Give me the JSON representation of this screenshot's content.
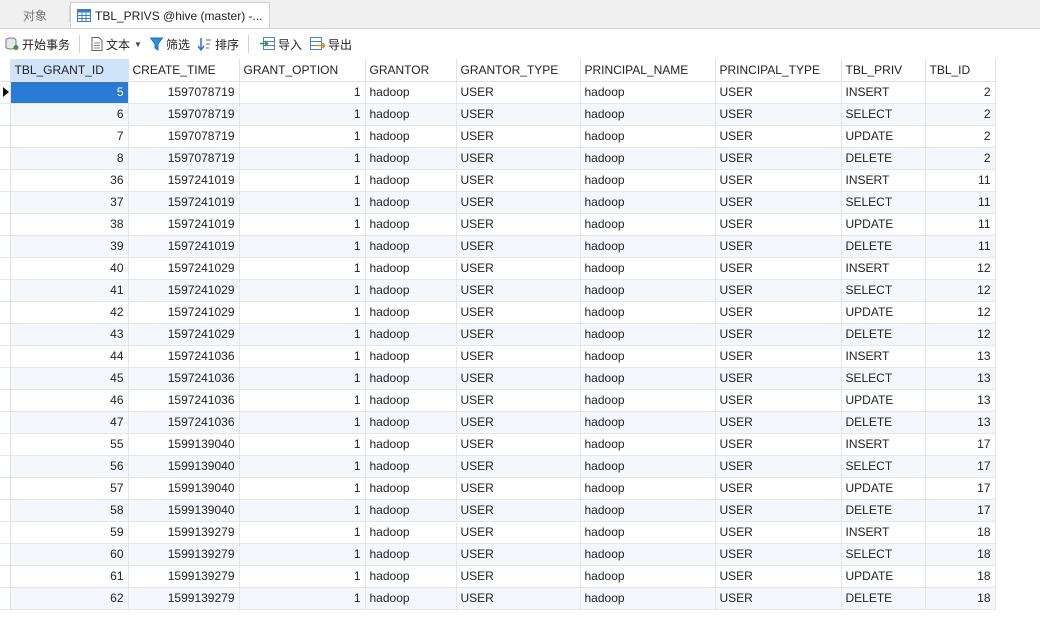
{
  "tabs": {
    "objects": "对象",
    "active": "TBL_PRIVS @hive (master) -..."
  },
  "toolbar": {
    "begin_transaction": "开始事务",
    "text": "文本",
    "filter": "筛选",
    "sort": "排序",
    "import": "导入",
    "export": "导出"
  },
  "colors": {
    "selection": "#2a7ad6",
    "header_selected": "#cfe4fb",
    "stripe": "#f4f8fd"
  },
  "columns": [
    "TBL_GRANT_ID",
    "CREATE_TIME",
    "GRANT_OPTION",
    "GRANTOR",
    "GRANTOR_TYPE",
    "PRINCIPAL_NAME",
    "PRINCIPAL_TYPE",
    "TBL_PRIV",
    "TBL_ID"
  ],
  "rows": [
    [
      "5",
      "1597078719",
      "1",
      "hadoop",
      "USER",
      "hadoop",
      "USER",
      "INSERT",
      "2"
    ],
    [
      "6",
      "1597078719",
      "1",
      "hadoop",
      "USER",
      "hadoop",
      "USER",
      "SELECT",
      "2"
    ],
    [
      "7",
      "1597078719",
      "1",
      "hadoop",
      "USER",
      "hadoop",
      "USER",
      "UPDATE",
      "2"
    ],
    [
      "8",
      "1597078719",
      "1",
      "hadoop",
      "USER",
      "hadoop",
      "USER",
      "DELETE",
      "2"
    ],
    [
      "36",
      "1597241019",
      "1",
      "hadoop",
      "USER",
      "hadoop",
      "USER",
      "INSERT",
      "11"
    ],
    [
      "37",
      "1597241019",
      "1",
      "hadoop",
      "USER",
      "hadoop",
      "USER",
      "SELECT",
      "11"
    ],
    [
      "38",
      "1597241019",
      "1",
      "hadoop",
      "USER",
      "hadoop",
      "USER",
      "UPDATE",
      "11"
    ],
    [
      "39",
      "1597241019",
      "1",
      "hadoop",
      "USER",
      "hadoop",
      "USER",
      "DELETE",
      "11"
    ],
    [
      "40",
      "1597241029",
      "1",
      "hadoop",
      "USER",
      "hadoop",
      "USER",
      "INSERT",
      "12"
    ],
    [
      "41",
      "1597241029",
      "1",
      "hadoop",
      "USER",
      "hadoop",
      "USER",
      "SELECT",
      "12"
    ],
    [
      "42",
      "1597241029",
      "1",
      "hadoop",
      "USER",
      "hadoop",
      "USER",
      "UPDATE",
      "12"
    ],
    [
      "43",
      "1597241029",
      "1",
      "hadoop",
      "USER",
      "hadoop",
      "USER",
      "DELETE",
      "12"
    ],
    [
      "44",
      "1597241036",
      "1",
      "hadoop",
      "USER",
      "hadoop",
      "USER",
      "INSERT",
      "13"
    ],
    [
      "45",
      "1597241036",
      "1",
      "hadoop",
      "USER",
      "hadoop",
      "USER",
      "SELECT",
      "13"
    ],
    [
      "46",
      "1597241036",
      "1",
      "hadoop",
      "USER",
      "hadoop",
      "USER",
      "UPDATE",
      "13"
    ],
    [
      "47",
      "1597241036",
      "1",
      "hadoop",
      "USER",
      "hadoop",
      "USER",
      "DELETE",
      "13"
    ],
    [
      "55",
      "1599139040",
      "1",
      "hadoop",
      "USER",
      "hadoop",
      "USER",
      "INSERT",
      "17"
    ],
    [
      "56",
      "1599139040",
      "1",
      "hadoop",
      "USER",
      "hadoop",
      "USER",
      "SELECT",
      "17"
    ],
    [
      "57",
      "1599139040",
      "1",
      "hadoop",
      "USER",
      "hadoop",
      "USER",
      "UPDATE",
      "17"
    ],
    [
      "58",
      "1599139040",
      "1",
      "hadoop",
      "USER",
      "hadoop",
      "USER",
      "DELETE",
      "17"
    ],
    [
      "59",
      "1599139279",
      "1",
      "hadoop",
      "USER",
      "hadoop",
      "USER",
      "INSERT",
      "18"
    ],
    [
      "60",
      "1599139279",
      "1",
      "hadoop",
      "USER",
      "hadoop",
      "USER",
      "SELECT",
      "18"
    ],
    [
      "61",
      "1599139279",
      "1",
      "hadoop",
      "USER",
      "hadoop",
      "USER",
      "UPDATE",
      "18"
    ],
    [
      "62",
      "1599139279",
      "1",
      "hadoop",
      "USER",
      "hadoop",
      "USER",
      "DELETE",
      "18"
    ]
  ],
  "numeric_columns": [
    0,
    1,
    2,
    8
  ],
  "selected_row": 0,
  "selected_column": 0
}
